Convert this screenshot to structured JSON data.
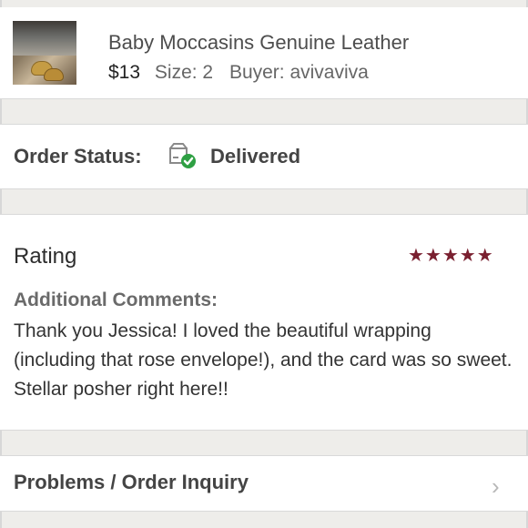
{
  "product": {
    "title": "Baby Moccasins Genuine Leather",
    "price": "$13",
    "size_label": "Size: 2",
    "buyer_label": "Buyer: avivaviva",
    "thumbnail_icon": "product-photo"
  },
  "order_status": {
    "label": "Order Status:",
    "value": "Delivered",
    "icon": "delivered-box-check-icon",
    "icon_color": "#2ea043"
  },
  "rating": {
    "title": "Rating",
    "stars": 5,
    "stars_display": "★★★★★",
    "star_color": "#7a2030",
    "comments_label": "Additional Comments:",
    "comments_text": "Thank you Jessica! I loved the beautiful wrapping (including that rose envelope!), and the card was so sweet. Stellar posher right here!!"
  },
  "problems": {
    "label": "Problems / Order Inquiry",
    "chevron_icon": "chevron-right-icon"
  }
}
